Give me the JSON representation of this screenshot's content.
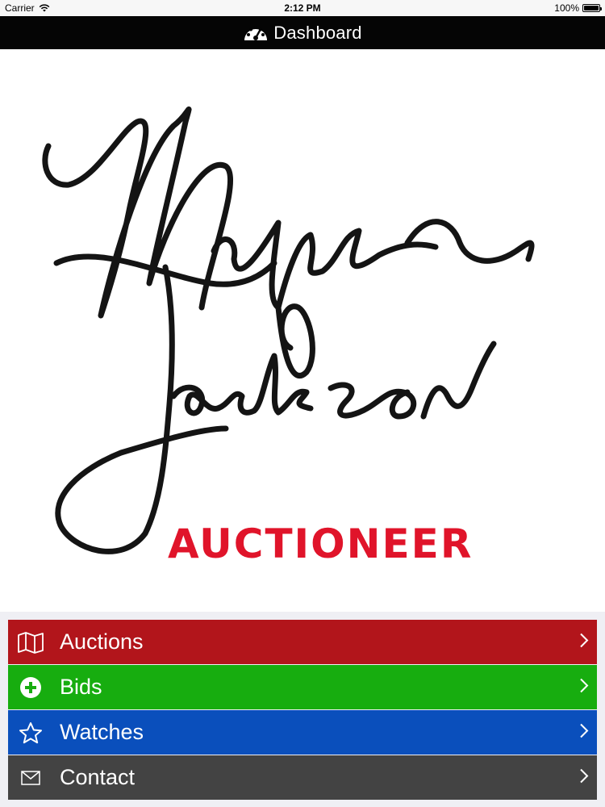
{
  "status_bar": {
    "carrier": "Carrier",
    "time": "2:12 PM",
    "battery": "100%"
  },
  "navbar": {
    "title": "Dashboard",
    "icon": "dashboard-gauge-icon"
  },
  "logo": {
    "signature_text": "Myers Jackson",
    "tagline": "AUCTIONEER",
    "tagline_color": "#e0142a"
  },
  "menu": {
    "items": [
      {
        "label": "Auctions",
        "icon": "map-icon",
        "color": "#b2151b"
      },
      {
        "label": "Bids",
        "icon": "plus-circle-icon",
        "color": "#17ad0f"
      },
      {
        "label": "Watches",
        "icon": "star-icon",
        "color": "#0a4fbc"
      },
      {
        "label": "Contact",
        "icon": "envelope-icon",
        "color": "#434343"
      }
    ]
  }
}
